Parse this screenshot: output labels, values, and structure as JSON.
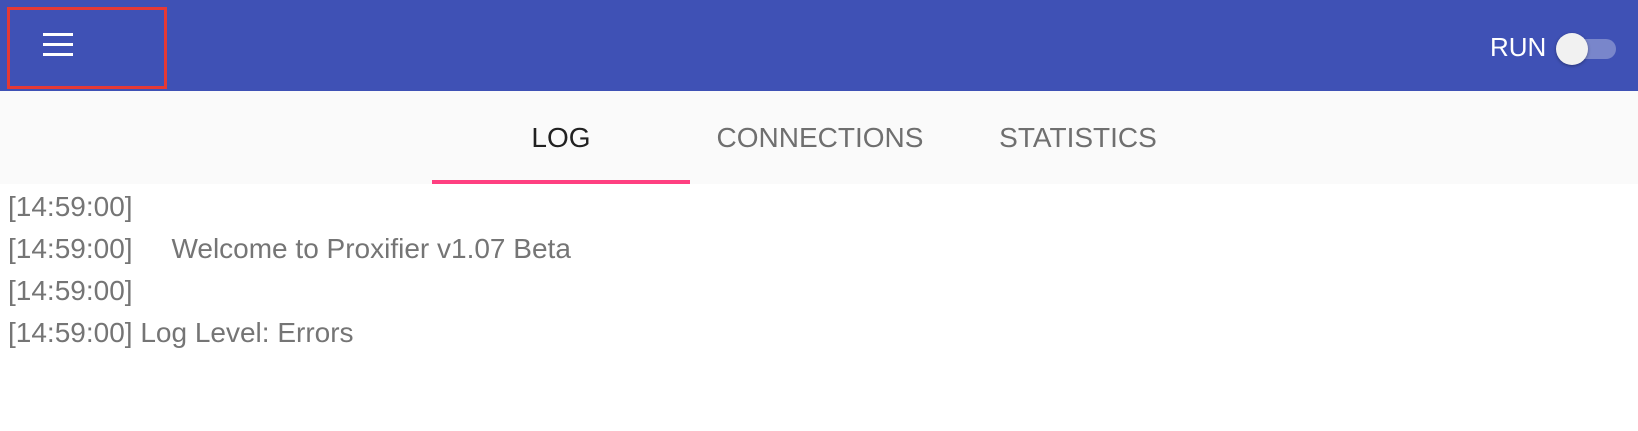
{
  "appbar": {
    "menu_icon": "hamburger-menu-icon",
    "run_label": "RUN",
    "run_switch": {
      "on": false,
      "thumb_color": "#f1f1f1",
      "track_color": "#7986cb"
    },
    "background": "#3f51b5"
  },
  "tabs": [
    {
      "label": "LOG",
      "active": true
    },
    {
      "label": "CONNECTIONS",
      "active": false
    },
    {
      "label": "STATISTICS",
      "active": false
    }
  ],
  "tab_indicator_color": "#ff4081",
  "log": {
    "lines": [
      "[14:59:00]",
      "[14:59:00]     Welcome to Proxifier v1.07 Beta",
      "[14:59:00]",
      "[14:59:00] Log Level: Errors"
    ]
  }
}
